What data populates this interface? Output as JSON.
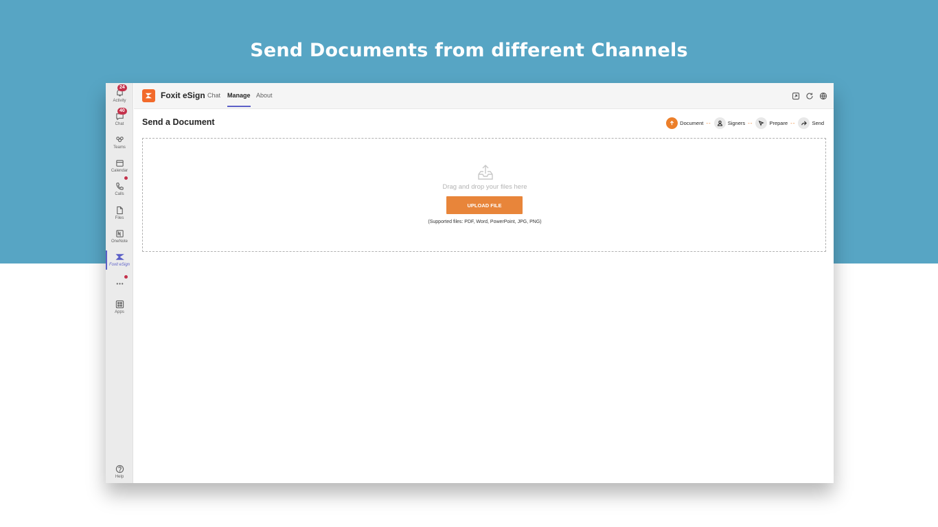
{
  "banner": {
    "headline": "Send Documents from different Channels",
    "color": "#57a5c4"
  },
  "rail": {
    "items": [
      {
        "label": "Activity",
        "icon": "bell-icon",
        "badge": "24"
      },
      {
        "label": "Chat",
        "icon": "chat-icon",
        "badge": "40"
      },
      {
        "label": "Teams",
        "icon": "teams-icon"
      },
      {
        "label": "Calendar",
        "icon": "calendar-icon"
      },
      {
        "label": "Calls",
        "icon": "phone-icon"
      },
      {
        "label": "Files",
        "icon": "file-icon"
      },
      {
        "label": "OneNote",
        "icon": "onenote-icon"
      },
      {
        "label": "Foxit eSign",
        "icon": "foxit-icon",
        "active": true
      },
      {
        "label": "",
        "icon": "more-icon"
      },
      {
        "label": "Apps",
        "icon": "apps-icon"
      },
      {
        "label": "Help",
        "icon": "help-icon"
      }
    ]
  },
  "app": {
    "title": "Foxit eSign",
    "tabs": [
      {
        "label": "Chat"
      },
      {
        "label": "Manage",
        "active": true
      },
      {
        "label": "About"
      }
    ],
    "brand_color": "#f26a2b"
  },
  "page": {
    "title": "Send a Document",
    "steps": [
      {
        "label": "Document",
        "icon": "upload-arrow-icon",
        "active": true
      },
      {
        "label": "Signers",
        "icon": "user-icon"
      },
      {
        "label": "Prepare",
        "icon": "cursor-icon"
      },
      {
        "label": "Send",
        "icon": "share-icon"
      }
    ],
    "step_separator": "--",
    "dropzone": {
      "text": "Drag and drop your files here",
      "button": "UPLOAD FILE",
      "supported": "(Supported files: PDF, Word, PowerPoint, JPG, PNG)"
    },
    "accent_color": "#e8853a"
  }
}
